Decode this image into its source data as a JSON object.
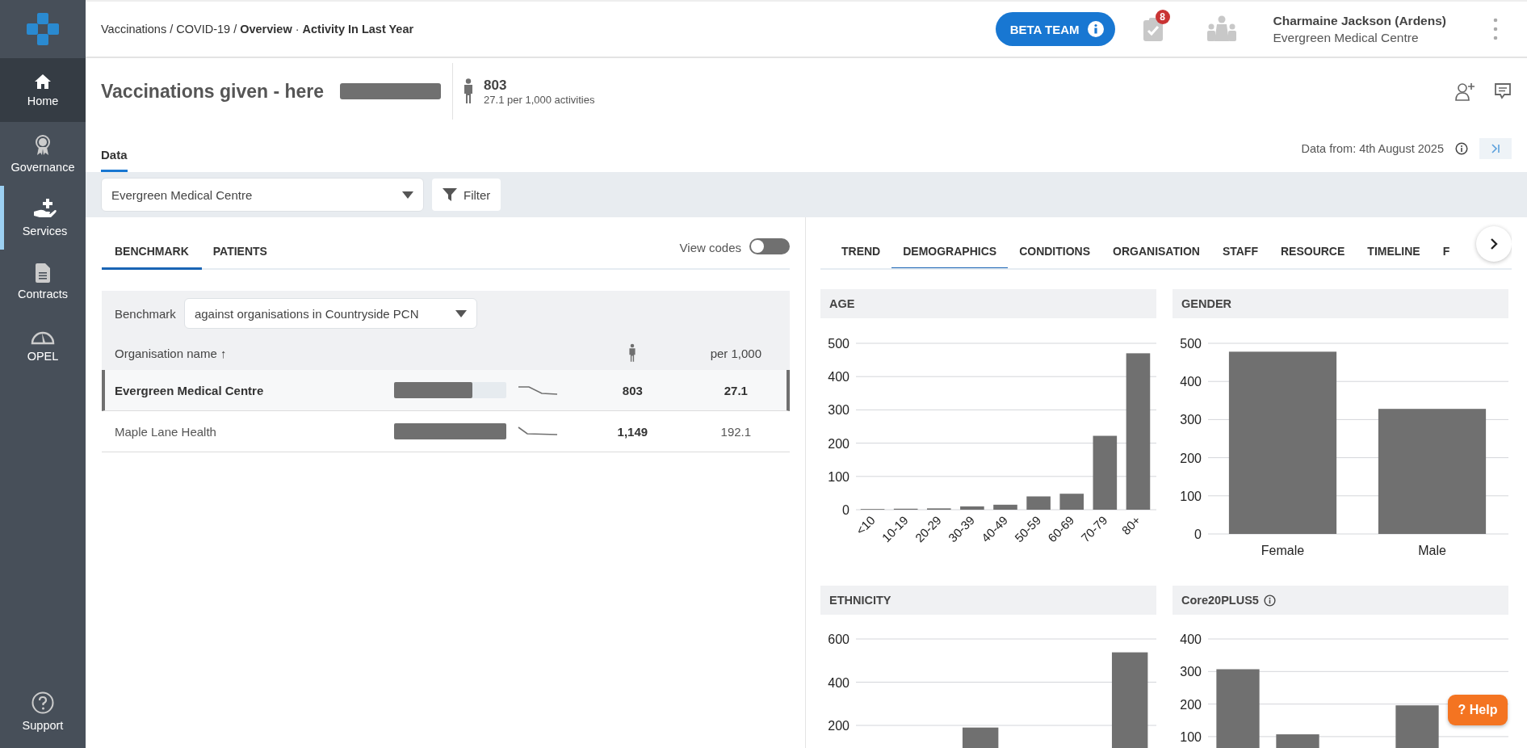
{
  "sidebar": {
    "items": [
      {
        "label": "Home",
        "selected": true,
        "marked": false
      },
      {
        "label": "Governance",
        "selected": false,
        "marked": false
      },
      {
        "label": "Services",
        "selected": false,
        "marked": true
      },
      {
        "label": "Contracts",
        "selected": false,
        "marked": false
      },
      {
        "label": "OPEL",
        "selected": false,
        "marked": false
      }
    ],
    "support": "Support"
  },
  "topbar": {
    "breadcrumb": "Vaccinations / COVID-19 / **Overview** · **Activity In Last Year**",
    "beta_button": "BETA TEAM",
    "tasks_badge": "8",
    "user_name": "Charmaine Jackson (Ardens)",
    "user_organisation": "Evergreen Medical Centre"
  },
  "header": {
    "title": "Vaccinations given - here",
    "total": "803",
    "rate": "27.1 per 1,000 activities"
  },
  "tabs": [
    {
      "label": "Data",
      "selected": true
    }
  ],
  "data_from": "Data from: 4th August 2025",
  "filter_bar": {
    "organisation": "Evergreen Medical Centre",
    "filter_button": "Filter"
  },
  "left_panel": {
    "tabs": [
      {
        "label": "BENCHMARK",
        "selected": true
      },
      {
        "label": "PATIENTS",
        "selected": false
      }
    ],
    "view_codes": {
      "label": "View codes",
      "on": false
    },
    "benchmark": {
      "label": "Benchmark",
      "value": "against organisations in Countryside PCN"
    },
    "table": {
      "columns": [
        "Organisation name ↑",
        "per 1,000"
      ],
      "rows": [
        {
          "name": "Evergreen Medical Centre",
          "level": 0.7,
          "count": "803",
          "rate": "27.1",
          "selected": true
        },
        {
          "name": "Maple Lane Health",
          "level": 1.0,
          "count": "1,149",
          "rate": "192.1",
          "selected": false
        }
      ]
    }
  },
  "right_panel": {
    "tabs": [
      {
        "label": "TREND",
        "selected": false
      },
      {
        "label": "DEMOGRAPHICS",
        "selected": true
      },
      {
        "label": "CONDITIONS",
        "selected": false
      },
      {
        "label": "ORGANISATION",
        "selected": false
      },
      {
        "label": "STAFF",
        "selected": false
      },
      {
        "label": "RESOURCE",
        "selected": false
      },
      {
        "label": "TIMELINE",
        "selected": false
      },
      {
        "label": "F",
        "selected": false
      }
    ],
    "charts": [
      {
        "title": "AGE",
        "info": false,
        "chart_data": {
          "type": "bar",
          "categories": [
            "<10",
            "10-19",
            "20-29",
            "30-39",
            "40-49",
            "50-59",
            "60-69",
            "70-79",
            "80+"
          ],
          "values": [
            2,
            3,
            4,
            10,
            15,
            40,
            48,
            222,
            470
          ],
          "grid": true,
          "ylim": [
            0,
            500
          ],
          "yticks": [
            0,
            100,
            200,
            300,
            400,
            500
          ]
        }
      },
      {
        "title": "GENDER",
        "info": false,
        "chart_data": {
          "type": "bar",
          "categories": [
            "Female",
            "Male"
          ],
          "values": [
            478,
            328
          ],
          "grid": true,
          "ylim": [
            0,
            500
          ],
          "yticks": [
            0,
            100,
            200,
            300,
            400,
            500
          ]
        }
      },
      {
        "title": "ETHNICITY",
        "info": false,
        "chart_data": {
          "type": "bar",
          "values": [
            null,
            null,
            190,
            null,
            null,
            538
          ],
          "grid": true,
          "ylim": [
            73,
            600
          ],
          "yticks": [
            200,
            400,
            600
          ]
        }
      },
      {
        "title": "Core20PLUS5",
        "info": true,
        "chart_data": {
          "type": "bar",
          "values": [
            307,
            107,
            null,
            196,
            null
          ],
          "grid": true,
          "ylim": [
            50,
            400
          ],
          "yticks": [
            100,
            200,
            300,
            400
          ]
        }
      }
    ]
  },
  "help_button": "? Help"
}
